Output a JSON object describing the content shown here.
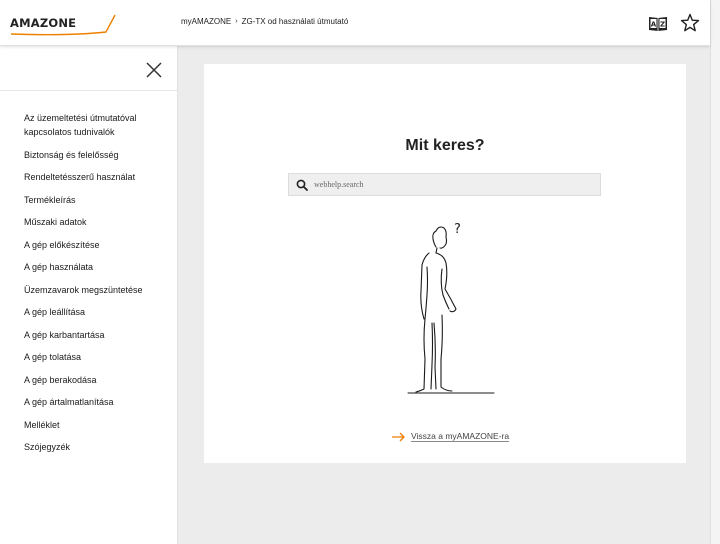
{
  "brand": {
    "logo_text": "AMAZONE",
    "accent_color": "#ee7f00"
  },
  "header": {
    "breadcrumb": [
      "myAMAZONE",
      "ZG-TX od használati útmutató"
    ],
    "breadcrumb_separator_icon": "chevron-right-icon",
    "language_icon": "language-az-icon",
    "favorite_icon": "star-outline-icon"
  },
  "sidebar": {
    "close_icon": "close-icon",
    "items": [
      {
        "label": "Az üzemeltetési útmutatóval kapcsolatos tudnivalók"
      },
      {
        "label": "Biztonság és felelősség"
      },
      {
        "label": "Rendeltetésszerű használat"
      },
      {
        "label": "Termékleírás"
      },
      {
        "label": "Műszaki adatok"
      },
      {
        "label": "A gép előkészítése"
      },
      {
        "label": "A gép használata"
      },
      {
        "label": "Üzemzavarok megszüntetése"
      },
      {
        "label": "A gép leállítása"
      },
      {
        "label": "A gép karbantartása"
      },
      {
        "label": "A gép tolatása"
      },
      {
        "label": "A gép berakodása"
      },
      {
        "label": "A gép ártalmatlanítása"
      },
      {
        "label": "Melléklet"
      },
      {
        "label": "Szójegyzék"
      }
    ]
  },
  "main": {
    "title": "Mit keres?",
    "search": {
      "placeholder": "webhelp.search",
      "value": ""
    },
    "illustration": {
      "question_mark": "?"
    },
    "back_link": "Vissza a myAMAZONE-ra"
  }
}
